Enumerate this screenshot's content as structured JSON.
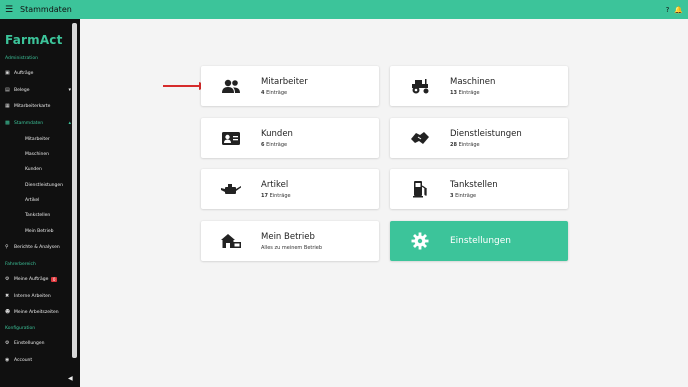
{
  "topbar": {
    "title": "Stammdaten",
    "help": "?",
    "bell_icon": "bell-icon",
    "menu_icon": "hamburger-icon"
  },
  "sidebar": {
    "logo": "FarmAct",
    "sections": {
      "admin": "Administration",
      "driver": "Fahrerbereich",
      "config": "Konfiguration"
    },
    "items": {
      "auftraege": "Aufträge",
      "belege": "Belege",
      "mitarbeiterkarte": "Mitarbeiterkarte",
      "stammdaten": "Stammdaten",
      "berichte": "Berichte & Analysen",
      "meine_auftraege": "Meine Aufträge",
      "meine_auftraege_badge": "0",
      "interne_arbeiten": "Interne Arbeiten",
      "meine_arbeitszeiten": "Meine Arbeitszeiten",
      "einstellungen": "Einstellungen",
      "account": "Account"
    },
    "subitems": [
      "Mitarbeiter",
      "Maschinen",
      "Kunden",
      "Dienstleistungen",
      "Artikel",
      "Tankstellen",
      "Mein Betrieb"
    ]
  },
  "cards": {
    "mitarbeiter": {
      "title": "Mitarbeiter",
      "count": "4",
      "unit": "Einträge"
    },
    "maschinen": {
      "title": "Maschinen",
      "count": "13",
      "unit": "Einträge"
    },
    "kunden": {
      "title": "Kunden",
      "count": "6",
      "unit": "Einträge"
    },
    "dienstleistungen": {
      "title": "Dienstleistungen",
      "count": "28",
      "unit": "Einträge"
    },
    "artikel": {
      "title": "Artikel",
      "count": "17",
      "unit": "Einträge"
    },
    "tankstellen": {
      "title": "Tankstellen",
      "count": "3",
      "unit": "Einträge"
    },
    "mein_betrieb": {
      "title": "Mein Betrieb",
      "subtitle": "Alles zu meinem Betrieb"
    },
    "einstellungen": {
      "title": "Einstellungen"
    }
  },
  "colors": {
    "accent": "#3cc49a",
    "sidebar": "#101010",
    "arrow": "#d62b2b"
  }
}
